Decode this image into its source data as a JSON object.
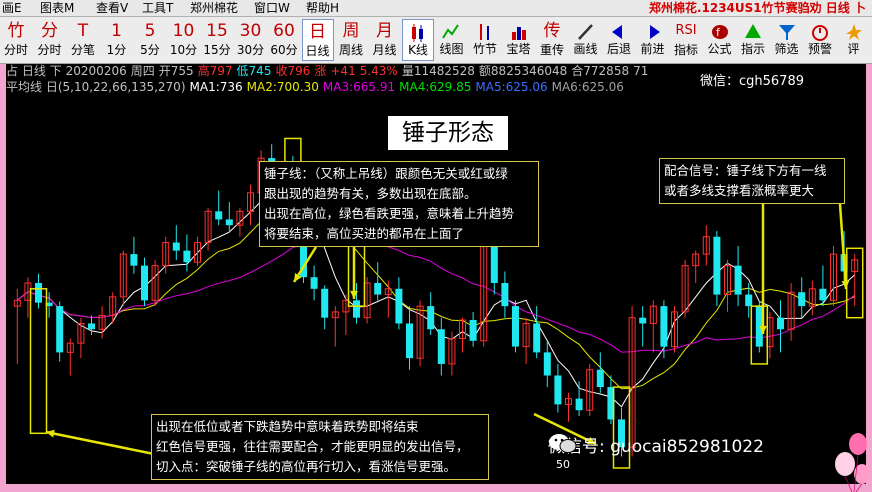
{
  "menu": {
    "items": [
      "画E",
      "图表M",
      "查看V",
      "工具T",
      "郑州棉花",
      "窗口W",
      "帮助H"
    ],
    "window_title": "郑州棉花.1234US1竹节赛驺劝 日线 卜"
  },
  "toolbar": {
    "items": [
      {
        "big": "竹",
        "label": "分时"
      },
      {
        "big": "分",
        "label": "分时"
      },
      {
        "big": "T",
        "label": "分笔"
      },
      {
        "big": "1",
        "label": "1分"
      },
      {
        "big": "5",
        "label": "5分"
      },
      {
        "big": "10",
        "label": "10分"
      },
      {
        "big": "15",
        "label": "15分"
      },
      {
        "big": "30",
        "label": "30分"
      },
      {
        "big": "60",
        "label": "60分"
      },
      {
        "big": "日",
        "label": "日线"
      },
      {
        "big": "周",
        "label": "周线"
      },
      {
        "big": "月",
        "label": "月线"
      },
      {
        "icon": "candlestick-icon",
        "label": "K线"
      },
      {
        "icon": "line-chart-icon",
        "label": "线图"
      },
      {
        "icon": "bamboo-icon",
        "label": "竹节"
      },
      {
        "icon": "tower-icon",
        "label": "宝塔"
      },
      {
        "big": "传",
        "label": "重传"
      },
      {
        "icon": "pen-icon",
        "label": "画线"
      },
      {
        "icon": "arrow-left-icon",
        "label": "后退"
      },
      {
        "icon": "arrow-right-icon",
        "label": "前进"
      },
      {
        "big": "RSI",
        "label": "指标"
      },
      {
        "icon": "formula-icon",
        "label": "公式"
      },
      {
        "icon": "signal-icon",
        "label": "指示"
      },
      {
        "icon": "filter-icon",
        "label": "筛选"
      },
      {
        "icon": "alarm-icon",
        "label": "预警"
      },
      {
        "icon": "star-icon",
        "label": "评"
      }
    ]
  },
  "info": {
    "line1": [
      "占 日线 下",
      "20200206",
      "周四",
      "开755",
      "高797",
      "低745",
      "收796",
      "涨",
      "+41",
      "5.43%",
      "量11482528",
      "额8825346048",
      "合772858",
      "71"
    ],
    "line2_title": "平均线 日(5,10,22,66,135,270)",
    "mas": [
      {
        "label": "MA1:736",
        "color": "#ffffff"
      },
      {
        "label": "MA2:700.30",
        "color": "#e6e600"
      },
      {
        "label": "MA3:665.91",
        "color": "#e000e0"
      },
      {
        "label": "MA4:629.85",
        "color": "#00e000"
      },
      {
        "label": "MA5:625.06",
        "color": "#3c6cff"
      },
      {
        "label": "MA6:625.06",
        "color": "#a0a0a0"
      }
    ]
  },
  "wechat_id": "微信：cgh56789",
  "annotations": {
    "title": "锤子形态",
    "hammer": [
      "锤子线：（又称上吊线）跟颜色无关或红或绿",
      "跟出现的趋势有关，多数出现在底部。",
      "出现在高位，绿色看跌更强，意味着上升趋势",
      "将要结束，高位买进的都吊在上面了"
    ],
    "confirm": [
      "配合信号：锤子线下方有一线",
      "或者多线支撑看涨概率更大"
    ],
    "low": [
      "出现在低位或者下跌趋势中意味着跌势即将结束",
      "红色信号更强，往往需要配合，才能更明显的发出信号，",
      "切入点：突破锤子线的高位再行切入，看涨信号更强。"
    ]
  },
  "axis_low_value": "50",
  "watermark": "微信号: guocai852981022",
  "colors": {
    "up": "#ff3030",
    "down": "#20e8f0",
    "ma1": "#ffffff",
    "ma2": "#e6e600",
    "ma3": "#e000e0",
    "highlight": "#e6e600"
  },
  "chart_data": {
    "type": "candlestick",
    "note_units": "price",
    "candles": [
      [
        700,
        715,
        650,
        705
      ],
      [
        705,
        725,
        690,
        720
      ],
      [
        720,
        728,
        698,
        703
      ],
      [
        703,
        712,
        690,
        700
      ],
      [
        700,
        704,
        652,
        660
      ],
      [
        660,
        672,
        640,
        668
      ],
      [
        668,
        690,
        655,
        685
      ],
      [
        685,
        692,
        675,
        680
      ],
      [
        680,
        700,
        672,
        692
      ],
      [
        692,
        712,
        685,
        708
      ],
      [
        708,
        748,
        700,
        745
      ],
      [
        745,
        760,
        728,
        735
      ],
      [
        735,
        742,
        700,
        705
      ],
      [
        705,
        740,
        700,
        735
      ],
      [
        735,
        760,
        728,
        755
      ],
      [
        755,
        770,
        740,
        748
      ],
      [
        748,
        762,
        730,
        738
      ],
      [
        738,
        760,
        735,
        755
      ],
      [
        755,
        785,
        748,
        782
      ],
      [
        782,
        800,
        770,
        775
      ],
      [
        775,
        790,
        765,
        770
      ],
      [
        770,
        785,
        760,
        782
      ],
      [
        782,
        805,
        770,
        798
      ],
      [
        798,
        835,
        790,
        828
      ],
      [
        828,
        840,
        805,
        812
      ],
      [
        812,
        825,
        800,
        820
      ],
      [
        820,
        830,
        795,
        800
      ],
      [
        800,
        815,
        720,
        725
      ],
      [
        725,
        735,
        705,
        715
      ],
      [
        715,
        718,
        680,
        690
      ],
      [
        690,
        700,
        665,
        695
      ],
      [
        695,
        710,
        675,
        705
      ],
      [
        705,
        720,
        685,
        690
      ],
      [
        690,
        725,
        685,
        720
      ],
      [
        720,
        738,
        705,
        710
      ],
      [
        710,
        722,
        690,
        715
      ],
      [
        715,
        725,
        680,
        685
      ],
      [
        685,
        700,
        645,
        655
      ],
      [
        655,
        705,
        648,
        700
      ],
      [
        700,
        712,
        675,
        680
      ],
      [
        680,
        690,
        640,
        650
      ],
      [
        650,
        678,
        640,
        672
      ],
      [
        672,
        690,
        660,
        688
      ],
      [
        688,
        695,
        665,
        670
      ],
      [
        670,
        760,
        665,
        755
      ],
      [
        755,
        775,
        710,
        720
      ],
      [
        720,
        730,
        690,
        700
      ],
      [
        700,
        705,
        660,
        665
      ],
      [
        665,
        690,
        650,
        685
      ],
      [
        685,
        700,
        655,
        660
      ],
      [
        660,
        670,
        630,
        640
      ],
      [
        640,
        650,
        608,
        615
      ],
      [
        615,
        625,
        600,
        620
      ],
      [
        620,
        635,
        605,
        610
      ],
      [
        610,
        650,
        605,
        645
      ],
      [
        645,
        660,
        625,
        630
      ],
      [
        630,
        640,
        598,
        602
      ],
      [
        602,
        612,
        570,
        578
      ],
      [
        578,
        700,
        570,
        690
      ],
      [
        690,
        700,
        665,
        685
      ],
      [
        685,
        705,
        660,
        700
      ],
      [
        700,
        705,
        655,
        665
      ],
      [
        665,
        700,
        660,
        695
      ],
      [
        695,
        740,
        690,
        735
      ],
      [
        735,
        748,
        720,
        745
      ],
      [
        745,
        770,
        735,
        760
      ],
      [
        760,
        765,
        700,
        710
      ],
      [
        710,
        740,
        695,
        735
      ],
      [
        735,
        752,
        700,
        710
      ],
      [
        710,
        720,
        690,
        700
      ],
      [
        700,
        705,
        660,
        665
      ],
      [
        665,
        695,
        655,
        690
      ],
      [
        690,
        705,
        660,
        680
      ],
      [
        680,
        720,
        670,
        712
      ],
      [
        712,
        725,
        690,
        700
      ],
      [
        700,
        722,
        692,
        715
      ],
      [
        715,
        735,
        700,
        705
      ],
      [
        705,
        752,
        700,
        745
      ],
      [
        745,
        765,
        720,
        730
      ],
      [
        730,
        745,
        700,
        740
      ]
    ],
    "price_range": [
      560,
      880
    ]
  }
}
